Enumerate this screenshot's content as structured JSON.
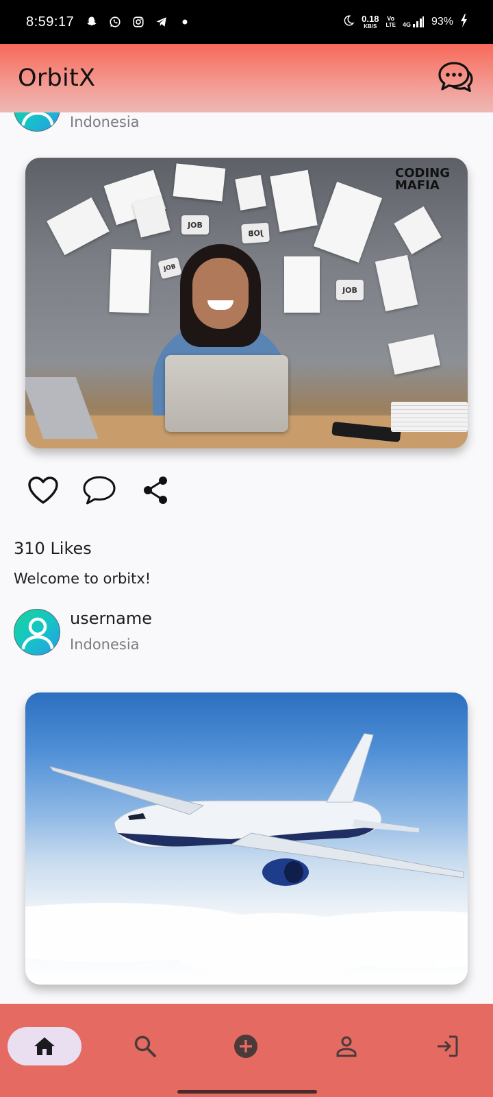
{
  "status_bar": {
    "time": "8:59:17",
    "net_speed_value": "0.18",
    "net_speed_unit": "KB/S",
    "volte_top": "Vo",
    "volte_bottom": "LTE",
    "network": "4G",
    "battery": "93%"
  },
  "app_bar": {
    "title": "OrbitX",
    "chat_icon": "chat-bubbles-icon"
  },
  "posts": [
    {
      "location": "Indonesia",
      "image_label": "CODING MAFIA",
      "image_texts": [
        "JOB",
        "JOB",
        "JOB",
        "JOB"
      ],
      "likes": "310 Likes",
      "caption": "Welcome to orbitx!"
    },
    {
      "username": "username",
      "location": "Indonesia"
    }
  ],
  "actions": [
    "heart-icon",
    "comment-icon",
    "share-icon"
  ],
  "bottom_nav": [
    {
      "name": "home-icon",
      "active": true
    },
    {
      "name": "search-icon",
      "active": false
    },
    {
      "name": "add-circle-icon",
      "active": false
    },
    {
      "name": "person-icon",
      "active": false
    },
    {
      "name": "logout-icon",
      "active": false
    }
  ],
  "colors": {
    "app_bar_top": "#f8695a",
    "bottom_nav": "#e56a62",
    "active_pill": "#eadff0",
    "avatar_gradient_start": "#19d39c",
    "avatar_gradient_end": "#2a9ae8"
  }
}
